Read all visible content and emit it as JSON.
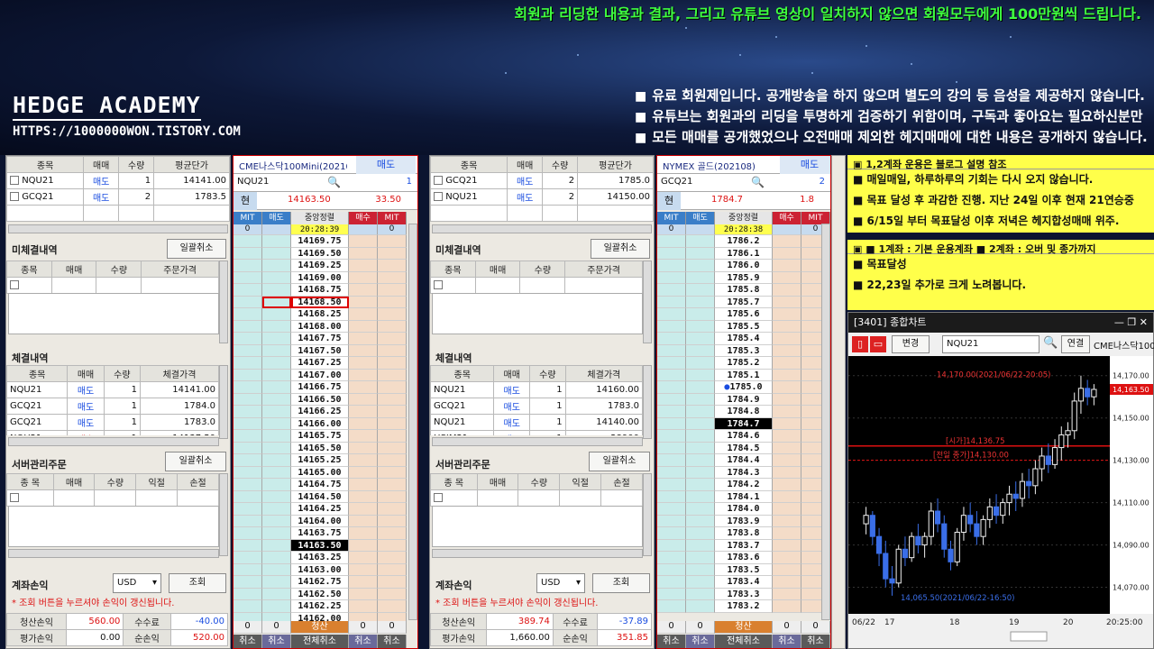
{
  "banner": "회원과 리딩한 내용과 결과, 그리고 유튜브 영상이 일치하지 않으면 회원모두에게 100만원씩 드립니다.",
  "brand": {
    "name": "HEDGE ACADEMY",
    "url": "HTTPS://1000000WON.TISTORY.COM"
  },
  "notice": [
    "유료 회원제입니다. 공개방송을 하지 않으며 별도의 강의 등 음성을 제공하지 않습니다.",
    "유튜브는 회원과의 리딩을 투명하게 검증하기 위함이며, 구독과 좋아요는 필요하신분만",
    "모든 매매를 공개했었으나 오전매매 제외한 헤지매매에 대한 내용은 공개하지 않습니다."
  ],
  "left": {
    "pos_headers": [
      "종목",
      "매매",
      "수량",
      "평균단가"
    ],
    "positions": [
      [
        "NQU21",
        "매도",
        "1",
        "14141.00"
      ],
      [
        "GCQ21",
        "매도",
        "2",
        "1783.5"
      ]
    ],
    "unfilled_title": "미체결내역",
    "cancel_all": "일괄취소",
    "unfilled_headers": [
      "종목",
      "매매",
      "수량",
      "주문가격"
    ],
    "filled_title": "체결내역",
    "filled_headers": [
      "종목",
      "매매",
      "수량",
      "체결가격"
    ],
    "filled": [
      [
        "NQU21",
        "매도",
        "1",
        "14141.00"
      ],
      [
        "GCQ21",
        "매도",
        "1",
        "1784.0"
      ],
      [
        "GCQ21",
        "매도",
        "1",
        "1783.0"
      ],
      [
        "NQU21",
        "매수",
        "1",
        "14137.50"
      ]
    ],
    "server_title": "서버관리주문",
    "server_cancel": "일괄취소",
    "server_headers": [
      "종 목",
      "매매",
      "수량",
      "익절",
      "손절"
    ],
    "acct_title": "계좌손익",
    "currency": "USD",
    "query": "조회",
    "warn": "* 조회 버튼을 누르셔야 손익이 갱신됩니다.",
    "summary": {
      "l1": "청산손익",
      "v1": "560.00",
      "l2": "수수료",
      "v2": "-40.00",
      "l3": "평가손익",
      "v3": "0.00",
      "l4": "순손익",
      "v4": "520.00"
    }
  },
  "ob1": {
    "title": "CME나스닥100Mini(202109)",
    "side": "매도",
    "symbol": "NQU21",
    "qty": "1",
    "cur_label": "현",
    "cur": "14163.50",
    "change": "33.50",
    "headers": [
      "MIT",
      "매도",
      "중앙정렬",
      "매수",
      "MIT"
    ],
    "top": [
      "0",
      "",
      "20:28:39",
      "",
      "0"
    ],
    "prices": [
      "14169.75",
      "14169.50",
      "14169.25",
      "14169.00",
      "14168.75",
      "14168.50",
      "14168.25",
      "14168.00",
      "14167.75",
      "14167.50",
      "14167.25",
      "14167.00",
      "14166.75",
      "14166.50",
      "14166.25",
      "14166.00",
      "14165.75",
      "14165.50",
      "14165.25",
      "14165.00",
      "14164.75",
      "14164.50",
      "14164.25",
      "14164.00",
      "14163.75",
      "14163.50",
      "14163.25",
      "14163.00",
      "14162.75",
      "14162.50",
      "14162.25",
      "14162.00"
    ],
    "bottom": [
      "0",
      "0",
      "청산",
      "0",
      "0"
    ],
    "footer": [
      "취소",
      "취소",
      "전체취소",
      "취소",
      "취소"
    ]
  },
  "right": {
    "pos_headers": [
      "종목",
      "매매",
      "수량",
      "평균단가"
    ],
    "positions": [
      [
        "GCQ21",
        "매도",
        "2",
        "1785.0"
      ],
      [
        "NQU21",
        "매도",
        "2",
        "14150.00"
      ]
    ],
    "unfilled_title": "미체결내역",
    "cancel_all": "일괄취소",
    "unfilled_headers": [
      "종목",
      "매매",
      "수량",
      "주문가격"
    ],
    "filled_title": "체결내역",
    "filled_headers": [
      "종목",
      "매매",
      "수량",
      "체결가격"
    ],
    "filled": [
      [
        "NQU21",
        "매도",
        "1",
        "14160.00"
      ],
      [
        "GCQ21",
        "매도",
        "1",
        "1783.0"
      ],
      [
        "NQU21",
        "매도",
        "1",
        "14140.00"
      ],
      [
        "HSIM21",
        "매도",
        "1",
        "28900"
      ]
    ],
    "server_title": "서버관리주문",
    "server_cancel": "일괄취소",
    "server_headers": [
      "종 목",
      "매매",
      "수량",
      "익절",
      "손절"
    ],
    "acct_title": "계좌손익",
    "currency": "USD",
    "query": "조회",
    "warn": "* 조회 버튼을 누르셔야 손익이 갱신됩니다.",
    "summary": {
      "l1": "청산손익",
      "v1": "389.74",
      "l2": "수수료",
      "v2": "-37.89",
      "l3": "평가손익",
      "v3": "1,660.00",
      "l4": "순손익",
      "v4": "351.85"
    }
  },
  "ob2": {
    "title": "NYMEX 골드(202108)",
    "side": "매도",
    "symbol": "GCQ21",
    "qty": "2",
    "cur_label": "현",
    "cur": "1784.7",
    "change": "1.8",
    "headers": [
      "MIT",
      "매도",
      "중앙정렬",
      "매수",
      "MIT"
    ],
    "top": [
      "0",
      "",
      "20:28:38",
      "",
      "0"
    ],
    "prices": [
      "1786.2",
      "1786.1",
      "1786.0",
      "1785.9",
      "1785.8",
      "1785.7",
      "1785.6",
      "1785.5",
      "1785.4",
      "1785.3",
      "1785.2",
      "1785.1",
      "1785.0",
      "1784.9",
      "1784.8",
      "1784.7",
      "1784.6",
      "1784.5",
      "1784.4",
      "1784.3",
      "1784.2",
      "1784.1",
      "1784.0",
      "1783.9",
      "1783.8",
      "1783.7",
      "1783.6",
      "1783.5",
      "1783.4",
      "1783.3",
      "1783.2"
    ],
    "bottom": [
      "0",
      "0",
      "청산",
      "0",
      "0"
    ],
    "footer": [
      "취소",
      "취소",
      "전체취소",
      "취소",
      "취소"
    ]
  },
  "note1": {
    "header": "1,2계좌 운용은 블로그 설명 참조",
    "lines": [
      "매일매일, 하루하루의 기회는 다시 오지 않습니다.",
      "목표 달성 후 과감한 진행. 지난 24일 이후 현재 21연승중",
      "6/15일 부터 목표달성 이후 저녁은 헤지합성매매 위주."
    ]
  },
  "note2": {
    "header": "■ 1계좌 : 기본 운용계좌 ■ 2계좌 : 오버 및 종가까지",
    "lines": [
      "목표달성",
      "22,23일 추가로 크게 노려봅니다."
    ]
  },
  "chart": {
    "title": "[3401] 종합차트",
    "period": "변경",
    "symbol": "NQU21",
    "link": "연결",
    "name": "CME나스닥100",
    "high_label": "14,170.00(2021/06/22-20:05)",
    "open_label": "[시가]14,136.75",
    "prev_label": "[전일 종가]14,130.00",
    "low_label": "14,065.50(2021/06/22-16:50)",
    "yticks": [
      "14,170.00",
      "14,150.00",
      "14,130.00",
      "14,110.00",
      "14,090.00",
      "14,070.00"
    ],
    "cur_price": "14,163.50",
    "xticks": [
      "06/22",
      "17",
      "18",
      "19",
      "20",
      "20:25:00"
    ],
    "ylim": [
      14060,
      14175
    ],
    "candles": [
      [
        14100,
        14108,
        14095,
        14104
      ],
      [
        14104,
        14106,
        14090,
        14094
      ],
      [
        14094,
        14098,
        14080,
        14086
      ],
      [
        14086,
        14092,
        14070,
        14074
      ],
      [
        14074,
        14080,
        14066,
        14072
      ],
      [
        14072,
        14090,
        14070,
        14088
      ],
      [
        14088,
        14094,
        14080,
        14084
      ],
      [
        14084,
        14096,
        14082,
        14094
      ],
      [
        14094,
        14100,
        14086,
        14090
      ],
      [
        14090,
        14096,
        14084,
        14094
      ],
      [
        14094,
        14110,
        14090,
        14106
      ],
      [
        14106,
        14112,
        14096,
        14100
      ],
      [
        14100,
        14104,
        14084,
        14088
      ],
      [
        14088,
        14092,
        14078,
        14082
      ],
      [
        14082,
        14098,
        14080,
        14096
      ],
      [
        14096,
        14108,
        14092,
        14104
      ],
      [
        14104,
        14110,
        14096,
        14100
      ],
      [
        14100,
        14106,
        14090,
        14094
      ],
      [
        14094,
        14104,
        14090,
        14102
      ],
      [
        14102,
        14112,
        14098,
        14108
      ],
      [
        14108,
        14114,
        14100,
        14104
      ],
      [
        14104,
        14112,
        14100,
        14110
      ],
      [
        14110,
        14118,
        14104,
        14114
      ],
      [
        14114,
        14120,
        14106,
        14112
      ],
      [
        14112,
        14124,
        14108,
        14120
      ],
      [
        14120,
        14126,
        14112,
        14118
      ],
      [
        14118,
        14130,
        14114,
        14126
      ],
      [
        14126,
        14136,
        14120,
        14132
      ],
      [
        14132,
        14138,
        14124,
        14128
      ],
      [
        14128,
        14140,
        14126,
        14136
      ],
      [
        14136,
        14146,
        14130,
        14142
      ],
      [
        14142,
        14148,
        14136,
        14144
      ],
      [
        14144,
        14162,
        14140,
        14158
      ],
      [
        14158,
        14170,
        14152,
        14164
      ],
      [
        14164,
        14168,
        14156,
        14160
      ],
      [
        14160,
        14166,
        14156,
        14163.5
      ]
    ]
  }
}
